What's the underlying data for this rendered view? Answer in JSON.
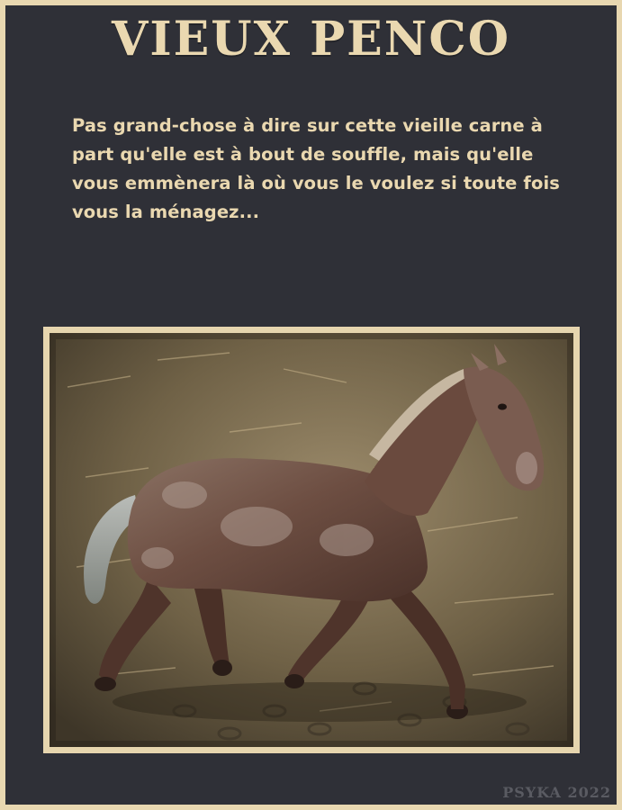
{
  "title": "VIEUX PENCO",
  "description": "Pas grand-chose à dire sur cette vieille carne à part qu'elle est à bout de souffle, mais qu'elle vous emmènera là où vous le voulez si toute fois vous la ménagez...",
  "signature": "PSYKA 2022",
  "colors": {
    "background": "#2f3037",
    "border": "#e8d7b0",
    "text": "#ead8b0",
    "signature": "#5a5b62"
  }
}
